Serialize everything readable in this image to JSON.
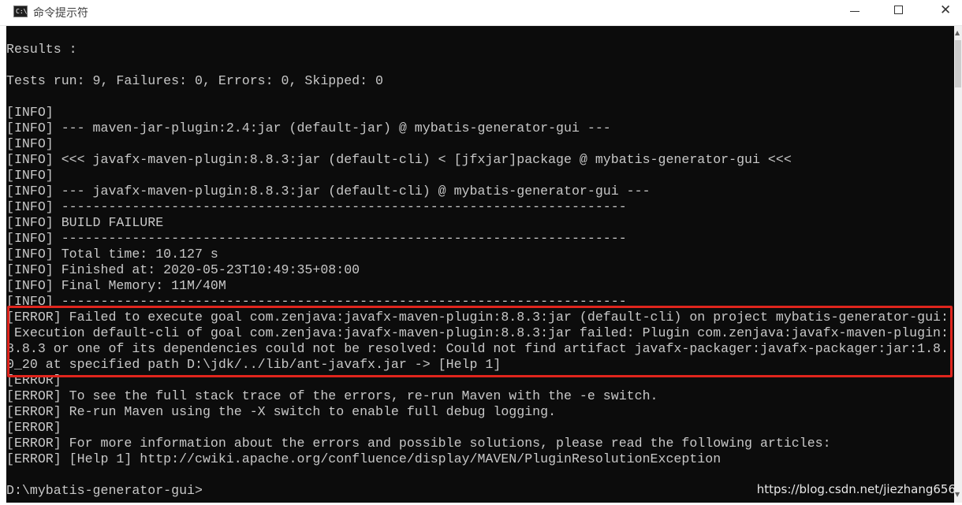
{
  "window": {
    "title": "命令提示符",
    "icon": "cmd-icon",
    "icon_text": "C:\\."
  },
  "console": {
    "lines": [
      "Results :",
      "",
      "Tests run: 9, Failures: 0, Errors: 0, Skipped: 0",
      "",
      "[INFO]",
      "[INFO] --- maven-jar-plugin:2.4:jar (default-jar) @ mybatis-generator-gui ---",
      "[INFO]",
      "[INFO] <<< javafx-maven-plugin:8.8.3:jar (default-cli) < [jfxjar]package @ mybatis-generator-gui <<<",
      "[INFO]",
      "[INFO] --- javafx-maven-plugin:8.8.3:jar (default-cli) @ mybatis-generator-gui ---",
      "[INFO] ------------------------------------------------------------------------",
      "[INFO] BUILD FAILURE",
      "[INFO] ------------------------------------------------------------------------",
      "[INFO] Total time: 10.127 s",
      "[INFO] Finished at: 2020-05-23T10:49:35+08:00",
      "[INFO] Final Memory: 11M/40M",
      "[INFO] ------------------------------------------------------------------------",
      "[ERROR] Failed to execute goal com.zenjava:javafx-maven-plugin:8.8.3:jar (default-cli) on project mybatis-generator-gui:",
      " Execution default-cli of goal com.zenjava:javafx-maven-plugin:8.8.3:jar failed: Plugin com.zenjava:javafx-maven-plugin:",
      "8.8.3 or one of its dependencies could not be resolved: Could not find artifact javafx-packager:javafx-packager:jar:1.8.",
      "0_20 at specified path D:\\jdk/../lib/ant-javafx.jar -> [Help 1]",
      "[ERROR]",
      "[ERROR] To see the full stack trace of the errors, re-run Maven with the -e switch.",
      "[ERROR] Re-run Maven using the -X switch to enable full debug logging.",
      "[ERROR]",
      "[ERROR] For more information about the errors and possible solutions, please read the following articles:",
      "[ERROR] [Help 1] http://cwiki.apache.org/confluence/display/MAVEN/PluginResolutionException",
      "",
      "D:\\mybatis-generator-gui>"
    ]
  },
  "watermark": "https://blog.csdn.net/jiezhang656",
  "colors": {
    "console_bg": "#0c0c0c",
    "console_text": "#c8c8c8",
    "highlight_border": "#e0251d"
  }
}
